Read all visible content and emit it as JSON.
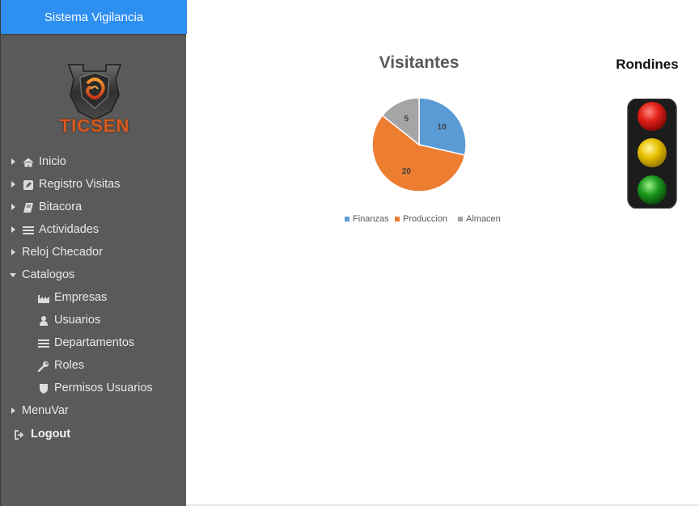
{
  "sidebar": {
    "brand": "Sistema Vigilancia",
    "logo_text": "TICSEN",
    "items": [
      {
        "label": "Inicio",
        "icon": "home-icon"
      },
      {
        "label": "Registro Visitas",
        "icon": "edit-icon"
      },
      {
        "label": "Bitacora",
        "icon": "book-icon"
      },
      {
        "label": "Actividades",
        "icon": "list-icon"
      },
      {
        "label": "Reloj Checador"
      },
      {
        "label": "Catalogos",
        "expanded": true,
        "children": [
          {
            "label": "Empresas",
            "icon": "industry-icon"
          },
          {
            "label": "Usuarios",
            "icon": "user-icon"
          },
          {
            "label": "Departamentos",
            "icon": "list-icon"
          },
          {
            "label": "Roles",
            "icon": "wrench-icon"
          },
          {
            "label": "Permisos Usuarios",
            "icon": "shield-icon"
          }
        ]
      },
      {
        "label": "MenuVar"
      }
    ],
    "logout": {
      "label": "Logout",
      "icon": "sign-out-icon"
    }
  },
  "colors": {
    "brand_bar": "#2d8ff0",
    "sidebar_bg": "#5a5a5a",
    "finanzas": "#5b9bd5",
    "produccion": "#ed7d31",
    "almacen": "#a5a5a5"
  },
  "chart_data": {
    "type": "pie",
    "title": "Visitantes",
    "categories": [
      "Finanzas",
      "Produccion",
      "Almacen"
    ],
    "values": [
      10,
      20,
      5
    ],
    "legend": "bottom",
    "data_labels": true
  },
  "rondines": {
    "title": "Rondines",
    "lights": [
      "red",
      "yellow",
      "green"
    ]
  }
}
